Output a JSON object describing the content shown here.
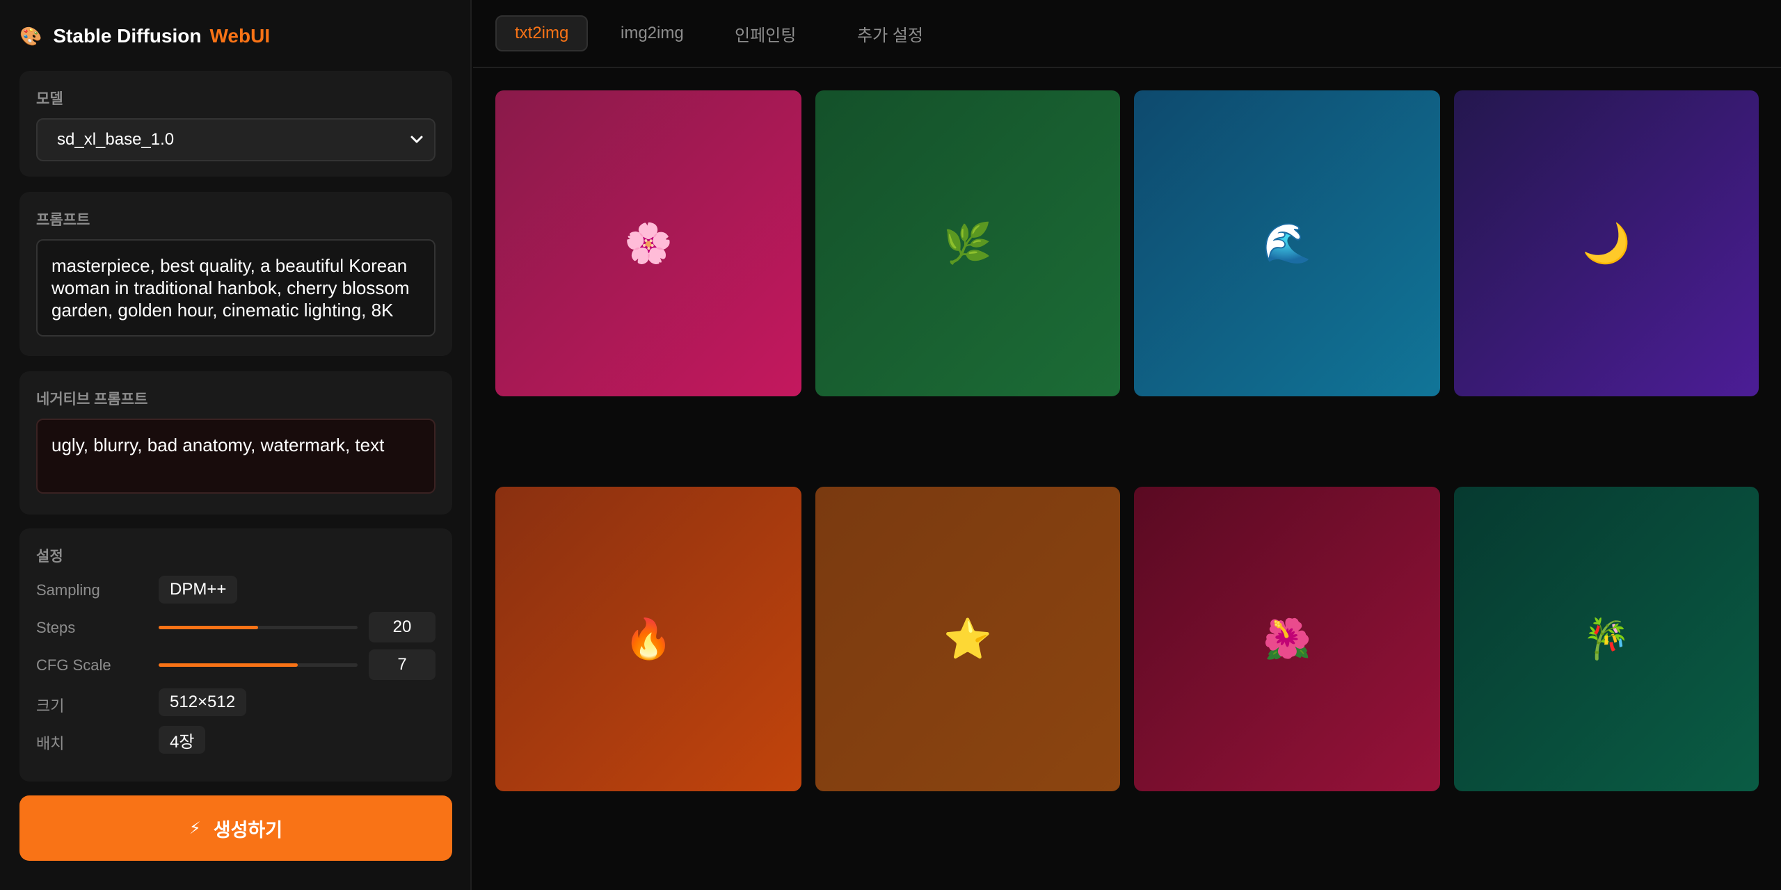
{
  "brand": {
    "icon": "🎨",
    "title": "Stable Diffusion",
    "accent": "WebUI",
    "accent_color": "#f97316"
  },
  "model": {
    "label": "모델",
    "selected": "sd_xl_base_1.0"
  },
  "prompt": {
    "label": "프롬프트",
    "value": "masterpiece, best quality, a beautiful Korean woman in traditional hanbok, cherry blossom garden, golden hour, cinematic lighting, 8K"
  },
  "negative": {
    "label": "네거티브 프롬프트",
    "value": "ugly, blurry, bad anatomy, watermark, text"
  },
  "settings": {
    "label": "설정",
    "sampling": {
      "label": "Sampling",
      "value": "DPM++"
    },
    "steps": {
      "label": "Steps",
      "value": "20",
      "fill_fraction": 0.5
    },
    "cfg": {
      "label": "CFG Scale",
      "value": "7",
      "fill_fraction": 0.7
    },
    "size": {
      "label": "크기",
      "value": "512×512"
    },
    "batch": {
      "label": "배치",
      "value": "4장"
    }
  },
  "generate": {
    "icon": "⚡",
    "label": "생성하기"
  },
  "tabs": [
    {
      "label": "txt2img",
      "active": true
    },
    {
      "label": "img2img",
      "active": false
    },
    {
      "label": "인페인팅",
      "active": false
    },
    {
      "label": "추가 설정",
      "active": false
    }
  ],
  "gallery": [
    {
      "name": "cherry-blossom-icon",
      "emoji": "🌸",
      "from": "#8a1a4a",
      "to": "#c4185e"
    },
    {
      "name": "herb-icon",
      "emoji": "🌿",
      "from": "#14512a",
      "to": "#1c6c36"
    },
    {
      "name": "wave-icon",
      "emoji": "🌊",
      "from": "#0e4a6e",
      "to": "#117598"
    },
    {
      "name": "crescent-moon-icon",
      "emoji": "🌙",
      "from": "#24174e",
      "to": "#4c1d96"
    },
    {
      "name": "fire-icon",
      "emoji": "🔥",
      "from": "#8a3010",
      "to": "#c2440c"
    },
    {
      "name": "star-icon",
      "emoji": "⭐",
      "from": "#7a3a10",
      "to": "#8c4510"
    },
    {
      "name": "hibiscus-icon",
      "emoji": "🌺",
      "from": "#5a0a22",
      "to": "#961239"
    },
    {
      "name": "bamboo-icon",
      "emoji": "🎋",
      "from": "#063a30",
      "to": "#0a5c44"
    }
  ]
}
